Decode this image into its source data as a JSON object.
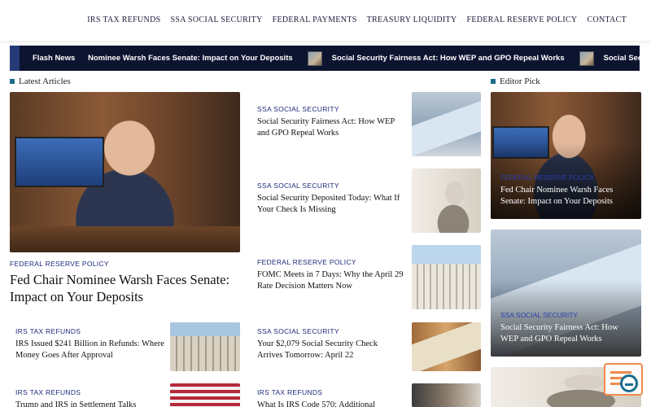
{
  "nav": {
    "items": [
      "IRS TAX REFUNDS",
      "SSA SOCIAL SECURITY",
      "FEDERAL PAYMENTS",
      "TREASURY LIQUIDITY",
      "FEDERAL RESERVE POLICY",
      "CONTACT"
    ]
  },
  "flash": {
    "label": "Flash News",
    "items": [
      "Nominee Warsh Faces Senate: Impact on Your Deposits",
      "Social Security Fairness Act: How WEP and GPO Repeal Works",
      "Social Security De"
    ]
  },
  "sections": {
    "latest": "Latest Articles",
    "editor": "Editor Pick"
  },
  "featured": {
    "category": "FEDERAL RESERVE POLICY",
    "title": "Fed Chair Nominee Warsh Faces Senate: Impact on Your Deposits"
  },
  "left_list": [
    {
      "category": "IRS TAX REFUNDS",
      "title": "IRS Issued $241 Billion in Refunds: Where Money Goes After Approval"
    },
    {
      "category": "IRS TAX REFUNDS",
      "title": "Trump and IRS in Settlement Talks"
    }
  ],
  "middle_list": [
    {
      "category": "SSA SOCIAL SECURITY",
      "title": "Social Security Fairness Act: How WEP and GPO Repeal Works"
    },
    {
      "category": "SSA SOCIAL SECURITY",
      "title": "Social Security Deposited Today: What If Your Check Is Missing"
    },
    {
      "category": "FEDERAL RESERVE POLICY",
      "title": "FOMC Meets in 7 Days: Why the April 29 Rate Decision Matters Now"
    },
    {
      "category": "SSA SOCIAL SECURITY",
      "title": "Your $2,079 Social Security Check Arrives Tomorrow: April 22"
    },
    {
      "category": "IRS TAX REFUNDS",
      "title": "What Is IRS Code 570: Additional"
    }
  ],
  "editor_picks": [
    {
      "category": "FEDERAL RESERVE POLICY",
      "title": "Fed Chair Nominee Warsh Faces Senate: Impact on Your Deposits"
    },
    {
      "category": "SSA SOCIAL SECURITY",
      "title": "Social Security Fairness Act: How WEP and GPO Repeal Works"
    }
  ],
  "icons": {
    "floating_button": "search-list-icon"
  },
  "colors": {
    "accent": "#1b6a8a",
    "category": "#1f2a7a",
    "flash_bg": "#0d1430",
    "float_border": "#f08a4b"
  }
}
